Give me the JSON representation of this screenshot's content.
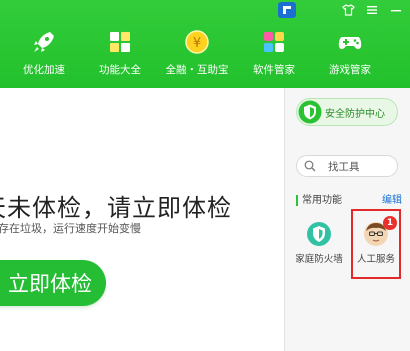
{
  "header": {
    "nav": [
      {
        "label": "优化加速",
        "icon": "rocket-icon"
      },
      {
        "label": "功能大全",
        "icon": "grid-icon"
      },
      {
        "label": "全融・互助宝",
        "icon": "coin-icon"
      },
      {
        "label": "软件管家",
        "icon": "software-icon"
      },
      {
        "label": "游戏管家",
        "icon": "gamepad-icon"
      }
    ],
    "window_controls": {
      "skin": "skin-icon",
      "menu": "menu-icon",
      "minimize": "minimize-icon"
    }
  },
  "main": {
    "headline": "天未体检，请立即体检",
    "subline": "存在垃圾，运行速度开始变慢",
    "cta_label": "立即体检"
  },
  "panel": {
    "security_center": "安全防护中心",
    "search_placeholder": "找工具",
    "section_title": "常用功能",
    "edit_label": "编辑",
    "tools": [
      {
        "label": "家庭防火墙",
        "icon": "firewall-icon"
      },
      {
        "label": "人工服务",
        "icon": "service-avatar-icon",
        "badge": "1"
      }
    ]
  },
  "colors": {
    "brand_green": "#2ac233",
    "highlight_red": "#e32a2a",
    "link_blue": "#1a73d6"
  }
}
